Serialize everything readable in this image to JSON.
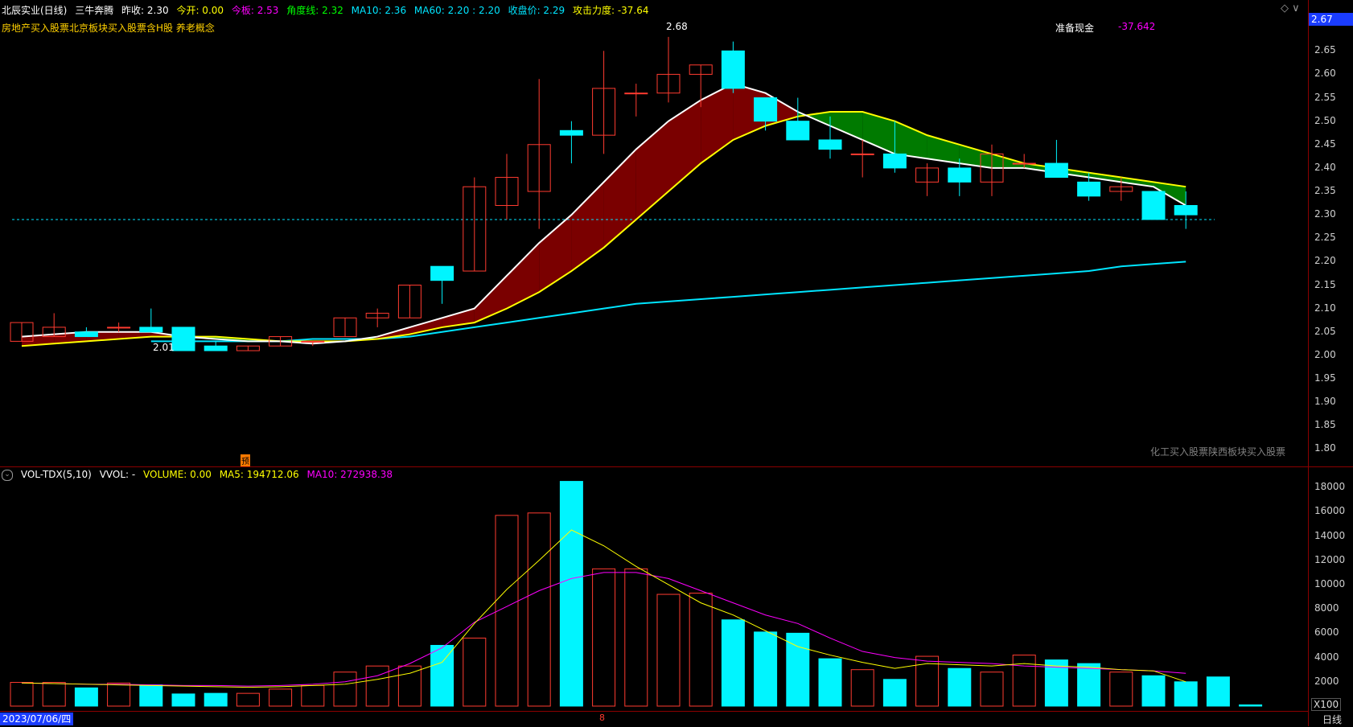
{
  "header": {
    "stock": "北辰实业(日线)",
    "indicator": "三牛奔腾",
    "prev_close": "昨收: 2.30",
    "open": "今开: 0.00",
    "today_label": "今板: 2.53",
    "angle": "角度线: 2.32",
    "ma10": "MA10: 2.36",
    "ma60": "MA60: 2.20 : 2.20",
    "close": "收盘价: 2.29",
    "attack": "攻击力度: -37.64",
    "concepts": "房地产买入股票北京板块买入股票含H股 养老概念",
    "cash_label": "准备现金",
    "cash_value": "-37.642",
    "high_label": "2.68",
    "low_label": "2.01",
    "pre_mark": "预",
    "side_note": "化工买入股票陕西板块买入股票"
  },
  "volume_header": {
    "name": "VOL-TDX(5,10)",
    "vvol": "VVOL: -",
    "volume": "VOLUME: 0.00",
    "ma5": "MA5: 194712.06",
    "ma10": "MA10: 272938.38"
  },
  "price_axis": [
    "2.65",
    "2.60",
    "2.55",
    "2.50",
    "2.45",
    "2.40",
    "2.35",
    "2.30",
    "2.25",
    "2.20",
    "2.15",
    "2.10",
    "2.05",
    "2.00",
    "1.95",
    "1.90",
    "1.85",
    "1.80"
  ],
  "current_price_tag": "2.67",
  "volume_axis": [
    "18000",
    "16000",
    "14000",
    "12000",
    "10000",
    "8000",
    "6000",
    "4000",
    "2000"
  ],
  "footer": {
    "date": "2023/07/06/四",
    "scale": "X100",
    "period": "日线",
    "cursor_mark": "8"
  },
  "colors": {
    "up": "#ff3b30",
    "down": "#00f5ff",
    "ma5": "#ffffff",
    "ma10": "#ffff00",
    "ma60": "#00e5ff",
    "band_up": "#7a0000",
    "band_down": "#007a00",
    "vol_ma10": "#ff00ff",
    "vol_ma5": "#ffff00"
  },
  "chart_data": {
    "type": "candlestick",
    "candles": [
      {
        "o": 2.03,
        "h": 2.07,
        "l": 2.03,
        "c": 2.07
      },
      {
        "o": 2.04,
        "h": 2.09,
        "l": 2.04,
        "c": 2.06
      },
      {
        "o": 2.05,
        "h": 2.06,
        "l": 2.04,
        "c": 2.04
      },
      {
        "o": 2.06,
        "h": 2.07,
        "l": 2.05,
        "c": 2.06
      },
      {
        "o": 2.06,
        "h": 2.1,
        "l": 2.06,
        "c": 2.05
      },
      {
        "o": 2.06,
        "h": 2.06,
        "l": 2.01,
        "c": 2.01
      },
      {
        "o": 2.02,
        "h": 2.03,
        "l": 2.01,
        "c": 2.01
      },
      {
        "o": 2.01,
        "h": 2.02,
        "l": 2.01,
        "c": 2.02
      },
      {
        "o": 2.02,
        "h": 2.04,
        "l": 2.02,
        "c": 2.04
      },
      {
        "o": 2.03,
        "h": 2.03,
        "l": 2.02,
        "c": 2.03
      },
      {
        "o": 2.04,
        "h": 2.08,
        "l": 2.04,
        "c": 2.08
      },
      {
        "o": 2.08,
        "h": 2.1,
        "l": 2.06,
        "c": 2.09
      },
      {
        "o": 2.08,
        "h": 2.15,
        "l": 2.08,
        "c": 2.15
      },
      {
        "o": 2.19,
        "h": 2.19,
        "l": 2.11,
        "c": 2.16
      },
      {
        "o": 2.18,
        "h": 2.38,
        "l": 2.18,
        "c": 2.36
      },
      {
        "o": 2.32,
        "h": 2.43,
        "l": 2.29,
        "c": 2.38
      },
      {
        "o": 2.35,
        "h": 2.59,
        "l": 2.27,
        "c": 2.45
      },
      {
        "o": 2.48,
        "h": 2.5,
        "l": 2.41,
        "c": 2.47
      },
      {
        "o": 2.47,
        "h": 2.65,
        "l": 2.43,
        "c": 2.57
      },
      {
        "o": 2.56,
        "h": 2.58,
        "l": 2.51,
        "c": 2.56
      },
      {
        "o": 2.56,
        "h": 2.68,
        "l": 2.54,
        "c": 2.6
      },
      {
        "o": 2.6,
        "h": 2.62,
        "l": 2.53,
        "c": 2.62
      },
      {
        "o": 2.65,
        "h": 2.67,
        "l": 2.56,
        "c": 2.57
      },
      {
        "o": 2.55,
        "h": 2.55,
        "l": 2.48,
        "c": 2.5
      },
      {
        "o": 2.5,
        "h": 2.55,
        "l": 2.46,
        "c": 2.46
      },
      {
        "o": 2.46,
        "h": 2.51,
        "l": 2.42,
        "c": 2.44
      },
      {
        "o": 2.43,
        "h": 2.46,
        "l": 2.38,
        "c": 2.43
      },
      {
        "o": 2.43,
        "h": 2.5,
        "l": 2.39,
        "c": 2.4
      },
      {
        "o": 2.37,
        "h": 2.41,
        "l": 2.34,
        "c": 2.4
      },
      {
        "o": 2.4,
        "h": 2.42,
        "l": 2.34,
        "c": 2.37
      },
      {
        "o": 2.37,
        "h": 2.45,
        "l": 2.34,
        "c": 2.43
      },
      {
        "o": 2.41,
        "h": 2.43,
        "l": 2.4,
        "c": 2.41
      },
      {
        "o": 2.41,
        "h": 2.46,
        "l": 2.38,
        "c": 2.38
      },
      {
        "o": 2.37,
        "h": 2.39,
        "l": 2.33,
        "c": 2.34
      },
      {
        "o": 2.35,
        "h": 2.38,
        "l": 2.33,
        "c": 2.36
      },
      {
        "o": 2.35,
        "h": 2.35,
        "l": 2.29,
        "c": 2.29
      },
      {
        "o": 2.32,
        "h": 2.35,
        "l": 2.27,
        "c": 2.3
      }
    ],
    "ma5": [
      2.04,
      2.045,
      2.05,
      2.05,
      2.05,
      2.04,
      2.035,
      2.03,
      2.03,
      2.025,
      2.03,
      2.04,
      2.06,
      2.08,
      2.1,
      2.17,
      2.24,
      2.3,
      2.37,
      2.44,
      2.5,
      2.545,
      2.58,
      2.56,
      2.52,
      2.49,
      2.46,
      2.43,
      2.42,
      2.41,
      2.4,
      2.4,
      2.39,
      2.38,
      2.37,
      2.36,
      2.32
    ],
    "ma10": [
      2.02,
      2.025,
      2.03,
      2.035,
      2.04,
      2.04,
      2.04,
      2.035,
      2.03,
      2.03,
      2.03,
      2.035,
      2.045,
      2.06,
      2.07,
      2.1,
      2.135,
      2.18,
      2.23,
      2.29,
      2.35,
      2.41,
      2.46,
      2.49,
      2.51,
      2.52,
      2.52,
      2.5,
      2.47,
      2.45,
      2.43,
      2.41,
      2.4,
      2.39,
      2.38,
      2.37,
      2.36
    ],
    "ma60": [
      null,
      null,
      null,
      null,
      2.03,
      2.03,
      2.03,
      2.03,
      2.03,
      2.035,
      2.035,
      2.035,
      2.04,
      2.05,
      2.06,
      2.07,
      2.08,
      2.09,
      2.1,
      2.11,
      2.115,
      2.12,
      2.125,
      2.13,
      2.135,
      2.14,
      2.145,
      2.15,
      2.155,
      2.16,
      2.165,
      2.17,
      2.175,
      2.18,
      2.19,
      2.195,
      2.2
    ],
    "volume": [
      1950,
      1950,
      1500,
      1900,
      1750,
      1000,
      1050,
      1050,
      1400,
      1700,
      2800,
      3300,
      3300,
      5000,
      5600,
      15700,
      15900,
      18500,
      11300,
      11300,
      9200,
      9300,
      7100,
      6100,
      6000,
      3900,
      3000,
      2200,
      4100,
      3100,
      2800,
      4200,
      3800,
      3500,
      2800,
      2500,
      2000,
      2400,
      100
    ],
    "vol_ma5": [
      1900,
      1850,
      1800,
      1750,
      1700,
      1650,
      1600,
      1550,
      1600,
      1700,
      1800,
      2200,
      2700,
      3600,
      6800,
      9600,
      12000,
      14500,
      13200,
      11500,
      10000,
      8500,
      7500,
      6200,
      4900,
      4200,
      3600,
      3100,
      3500,
      3400,
      3300,
      3500,
      3300,
      3200,
      3000,
      2900,
      2000
    ],
    "vol_ma10": [
      1900,
      1850,
      1800,
      1800,
      1750,
      1700,
      1700,
      1650,
      1700,
      1800,
      2000,
      2500,
      3500,
      4800,
      6900,
      8200,
      9500,
      10500,
      11000,
      11000,
      10500,
      9500,
      8500,
      7500,
      6800,
      5600,
      4500,
      4000,
      3700,
      3600,
      3500,
      3300,
      3200,
      3100,
      3000,
      2900,
      2700
    ],
    "price_range": [
      1.78,
      2.69
    ],
    "volume_range": [
      0,
      19200
    ]
  }
}
